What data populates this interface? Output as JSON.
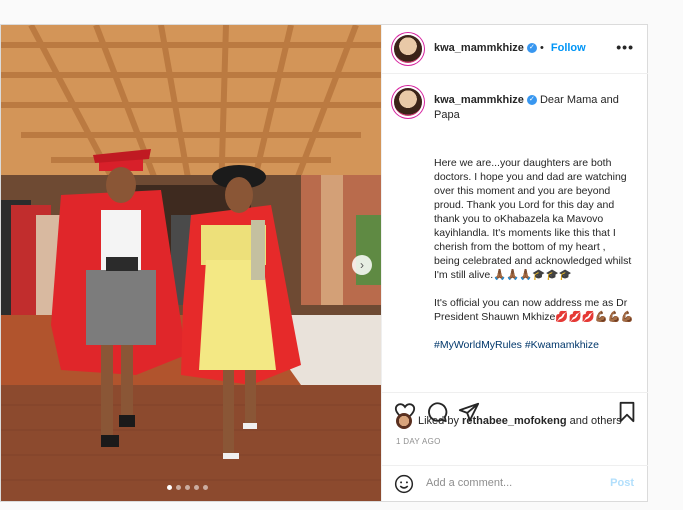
{
  "post": {
    "username": "kwa_mammkhize",
    "follow_label": "Follow",
    "more_label": "•••",
    "verified_mark": "✓",
    "caption_lead": "Dear Mama and Papa",
    "caption_para1": "Here we are...your daughters are both doctors. I hope you and dad are watching over this moment and you are beyond proud. Thank you Lord for this day and thank you to oKhabazela ka Mavovo kayihlandla. It's moments like this that I cherish from the bottom of my heart , being celebrated and acknowledged whilst I'm still alive.🙏🏾🙏🏾🙏🏾🎓🎓🎓",
    "caption_para2": "It's official you can now address me as Dr President Shauwn Mkhize💋💋💋💪🏾💪🏾💪🏾",
    "hashtag1": "#MyWorldMyRules",
    "hashtag2": "#Kwamamkhize",
    "likes_prefix": "Liked by ",
    "likes_user": "rethabee_mofokeng",
    "likes_suffix": " and others",
    "time_ago": "1 DAY AGO",
    "comment_placeholder": "Add a comment...",
    "post_button": "Post",
    "next_arrow": "›"
  },
  "icons": [
    "more-icon",
    "verified-icon",
    "heart-icon",
    "comment-icon",
    "share-icon",
    "bookmark-icon",
    "emoji-icon",
    "next-arrow-icon"
  ],
  "colors": {
    "accent": "#0095f6",
    "verified": "#3897f0",
    "post_disabled": "#b2dffc",
    "hashtag": "#00376b"
  },
  "carousel": {
    "total": 5,
    "active": 1
  }
}
